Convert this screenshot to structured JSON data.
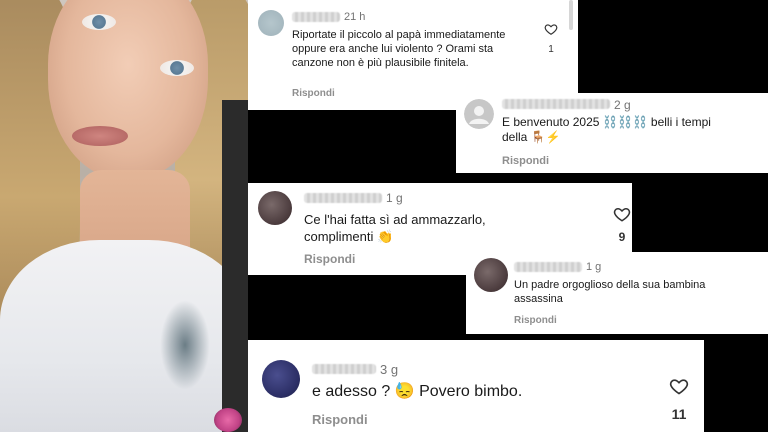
{
  "comments": [
    {
      "time": "21 h",
      "text": "Riportate il piccolo al papà immediatamente oppure era anche lui violento ? Orami sta canzone non è più plausibile finitela.",
      "reply_label": "Rispondi",
      "likes": "1"
    },
    {
      "time": "2 g",
      "text": "E benvenuto 2025 ⛓️⛓️⛓️ belli i tempi della 🪑⚡",
      "reply_label": "Rispondi"
    },
    {
      "time": "1 g",
      "text": "Ce l'hai fatta sì ad ammazzarlo, complimenti 👏",
      "reply_label": "Rispondi",
      "likes": "9"
    },
    {
      "time": "1 g",
      "text": "Un padre orgoglioso della sua bambina assassina",
      "reply_label": "Rispondi"
    },
    {
      "time": "3 g",
      "text": "e adesso ? 😓 Povero bimbo.",
      "reply_label": "Rispondi",
      "likes": "11"
    }
  ],
  "icons": {
    "like": "heart-outline-icon",
    "default_avatar": "person-silhouette-icon"
  },
  "colors": {
    "muted_text": "#8e8e8e",
    "body_text": "#1a1a1a",
    "card_bg": "#ffffff"
  }
}
